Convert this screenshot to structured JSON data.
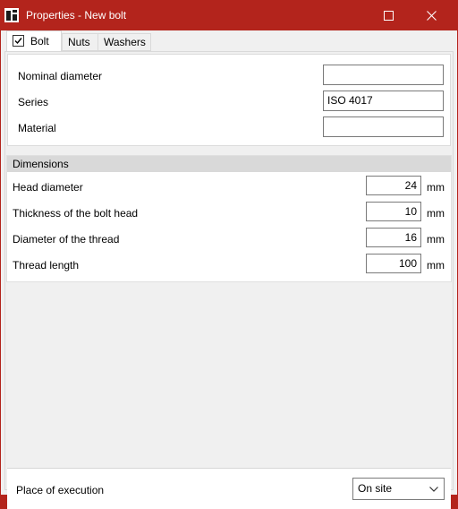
{
  "window": {
    "title": "Properties - New bolt",
    "titlebar_color": "#b3241c",
    "icon": "app-icon"
  },
  "tabs": [
    {
      "label": "Bolt",
      "checked": true,
      "active": true
    },
    {
      "label": "Nuts",
      "active": false
    },
    {
      "label": "Washers",
      "active": false
    }
  ],
  "general": {
    "nominal_diameter": {
      "label": "Nominal diameter",
      "value": ""
    },
    "series": {
      "label": "Series",
      "value": "ISO 4017"
    },
    "material": {
      "label": "Material",
      "value": ""
    }
  },
  "dimensions": {
    "header": "Dimensions",
    "rows": [
      {
        "label": "Head diameter",
        "value": "24",
        "unit": "mm"
      },
      {
        "label": "Thickness of the bolt head",
        "value": "10",
        "unit": "mm"
      },
      {
        "label": "Diameter of the thread",
        "value": "16",
        "unit": "mm"
      },
      {
        "label": "Thread length",
        "value": "100",
        "unit": "mm"
      }
    ]
  },
  "footer": {
    "place_label": "Place of execution",
    "place_value": "On site"
  }
}
